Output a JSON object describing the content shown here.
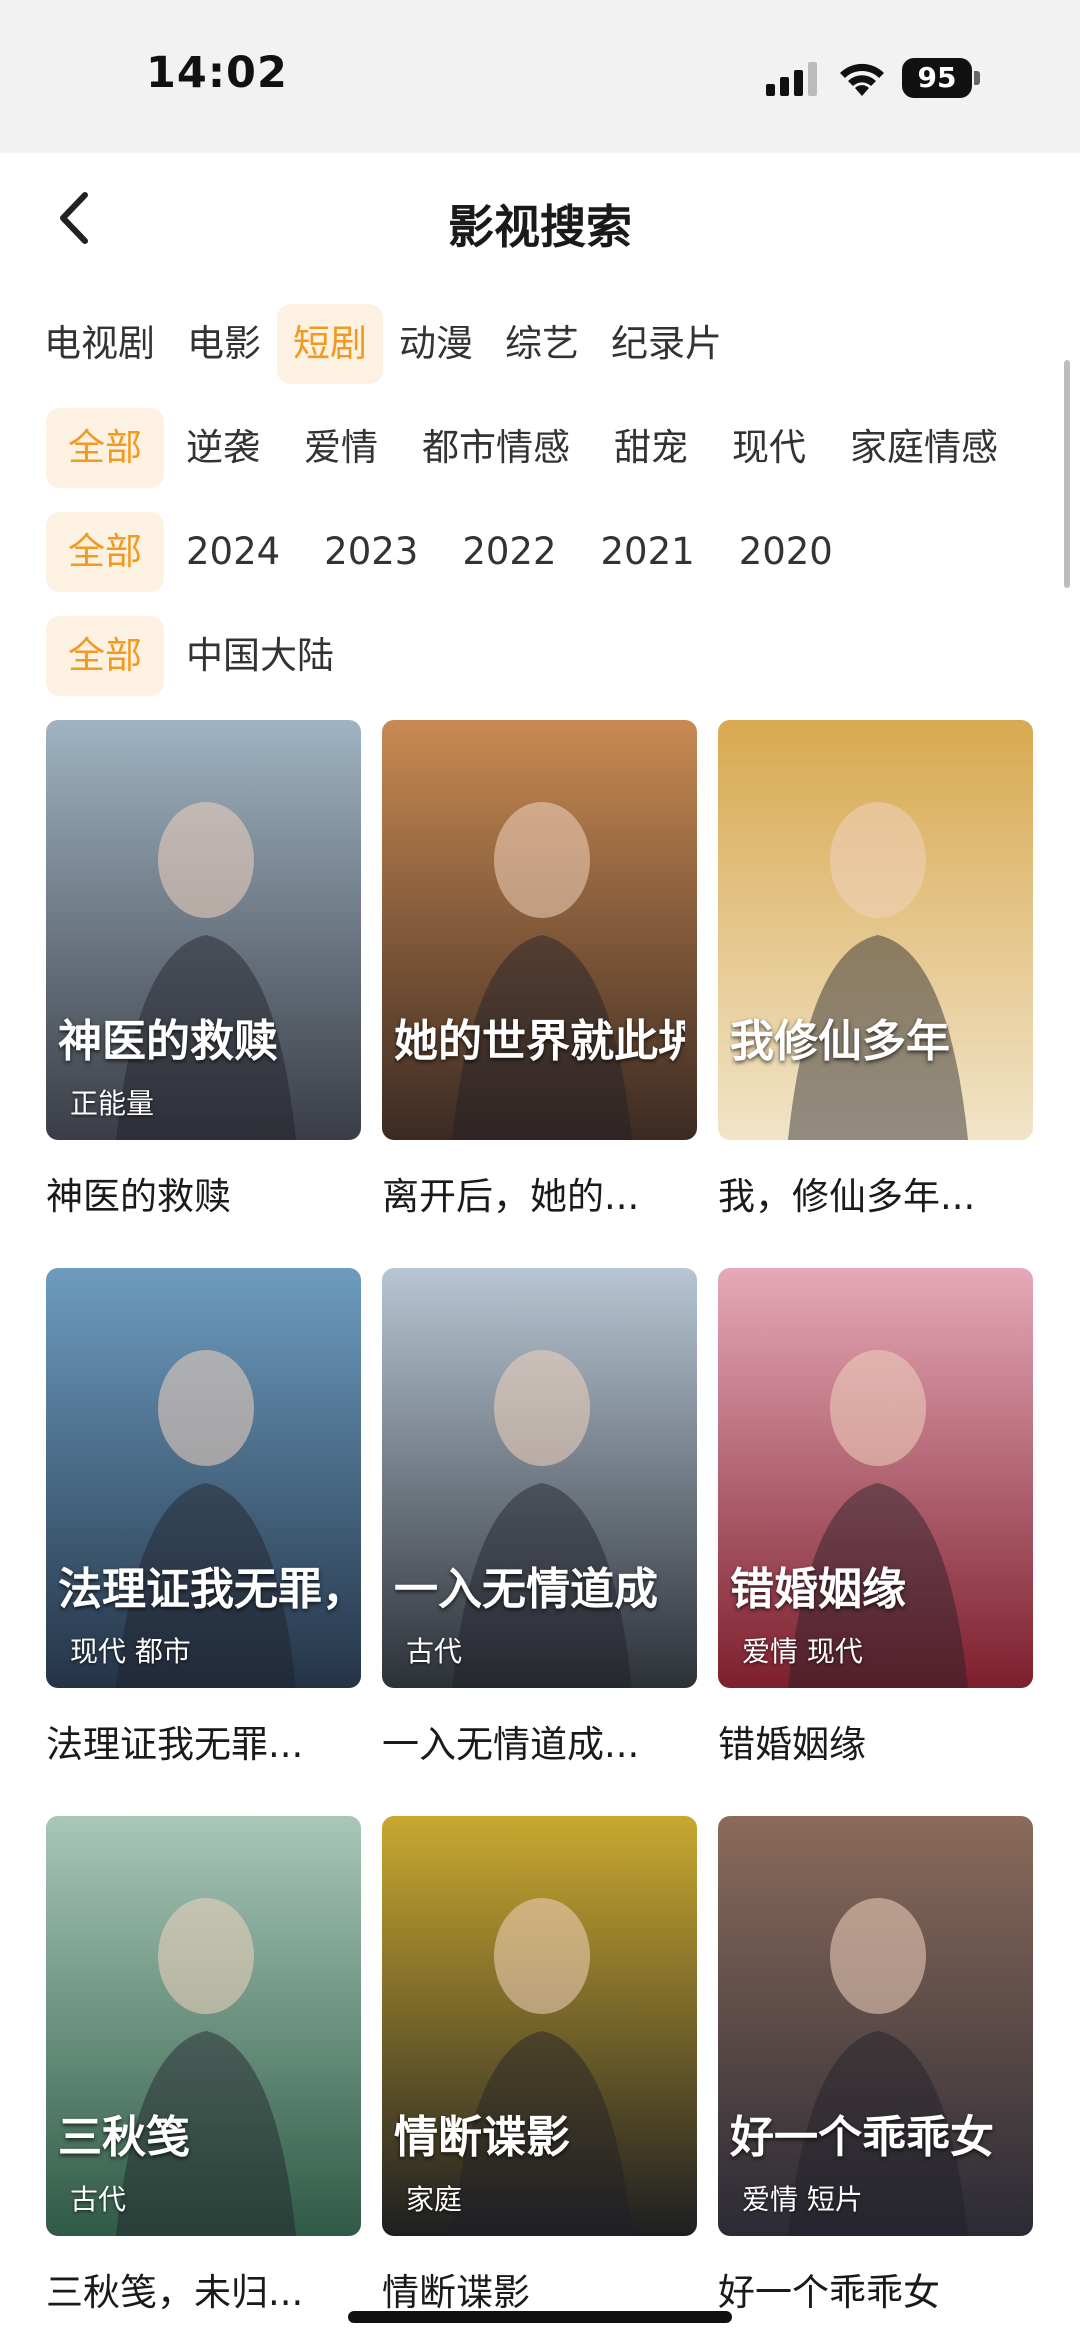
{
  "status_bar": {
    "time": "14:02",
    "battery": "95"
  },
  "header": {
    "title": "影视搜索"
  },
  "category_tabs": [
    {
      "label": "电视剧",
      "active": false
    },
    {
      "label": "电影",
      "active": false
    },
    {
      "label": "短剧",
      "active": true
    },
    {
      "label": "动漫",
      "active": false
    },
    {
      "label": "综艺",
      "active": false
    },
    {
      "label": "纪录片",
      "active": false
    }
  ],
  "genre_filters": [
    {
      "label": "全部",
      "active": true
    },
    {
      "label": "逆袭",
      "active": false
    },
    {
      "label": "爱情",
      "active": false
    },
    {
      "label": "都市情感",
      "active": false
    },
    {
      "label": "甜宠",
      "active": false
    },
    {
      "label": "现代",
      "active": false
    },
    {
      "label": "家庭情感",
      "active": false
    }
  ],
  "year_filters": [
    {
      "label": "全部",
      "active": true
    },
    {
      "label": "2024",
      "active": false
    },
    {
      "label": "2023",
      "active": false
    },
    {
      "label": "2022",
      "active": false
    },
    {
      "label": "2021",
      "active": false
    },
    {
      "label": "2020",
      "active": false
    }
  ],
  "region_filters": [
    {
      "label": "全部",
      "active": true
    },
    {
      "label": "中国大陆",
      "active": false
    }
  ],
  "results": [
    {
      "title": "神医的救赎",
      "tag": "正能量",
      "poster_text": "神医的救赎",
      "colors": [
        "#9fb3c2",
        "#3a3d45"
      ]
    },
    {
      "title": "离开后，她的...",
      "tag": "",
      "poster_text": "她的世界就此坍塌",
      "colors": [
        "#c98a52",
        "#3b2a22"
      ]
    },
    {
      "title": "我，修仙多年...",
      "tag": "",
      "poster_text": "我修仙多年",
      "colors": [
        "#d8a950",
        "#f1e4c8"
      ]
    },
    {
      "title": "法理证我无罪...",
      "tag": "现代 都市",
      "poster_text": "法理证我无罪，",
      "colors": [
        "#6d9cc0",
        "#243447"
      ]
    },
    {
      "title": "一入无情道成...",
      "tag": "古代",
      "poster_text": "一入无情道成",
      "colors": [
        "#b7c6d3",
        "#2d3138"
      ]
    },
    {
      "title": "错婚姻缘",
      "tag": "爱情 现代",
      "poster_text": "错婚姻缘",
      "colors": [
        "#e6a9b8",
        "#7d1f2d"
      ]
    },
    {
      "title": "三秋笺，未归...",
      "tag": "古代",
      "poster_text": "三秋笺",
      "colors": [
        "#a8c7b8",
        "#2f5a46"
      ]
    },
    {
      "title": "情断谍影",
      "tag": "家庭",
      "poster_text": "情断谍影",
      "colors": [
        "#c9a830",
        "#1e1e22"
      ]
    },
    {
      "title": "好一个乖乖女",
      "tag": "爱情 短片",
      "poster_text": "好一个乖乖女",
      "colors": [
        "#8b6b5a",
        "#2b2a35"
      ]
    }
  ],
  "colors": {
    "accent": "#f29a1f",
    "accent_bg": "#fdf1e2"
  }
}
